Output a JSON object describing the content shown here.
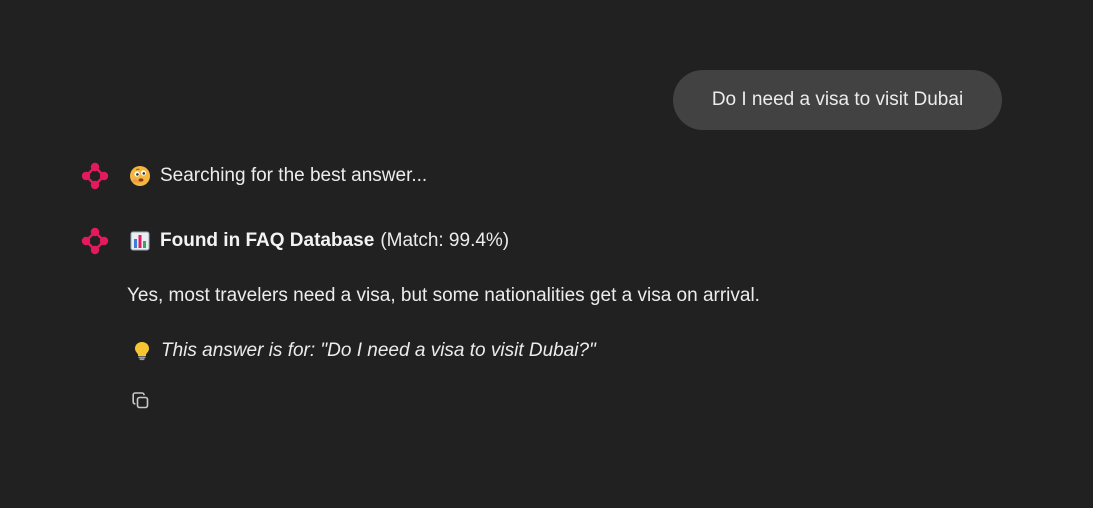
{
  "user_message": {
    "text": "Do I need a visa to visit Dubai"
  },
  "assistant": {
    "status": {
      "emoji_icon": "thinking-face-icon",
      "text": "Searching for the best answer..."
    },
    "result_header": {
      "emoji_icon": "bar-chart-icon",
      "source_label": "Found in FAQ Database",
      "match_text": "(Match: 99.4%)"
    },
    "answer": "Yes, most travelers need a visa, but some nationalities get a visa on arrival.",
    "note": {
      "emoji_icon": "lightbulb-icon",
      "text": "This answer is for: \"Do I need a visa to visit Dubai?\""
    },
    "actions": {
      "copy_icon": "copy-icon"
    }
  },
  "colors": {
    "background": "#212121",
    "user_bubble": "#424242",
    "text": "#ececec",
    "avatar_accent": "#e5195f"
  }
}
